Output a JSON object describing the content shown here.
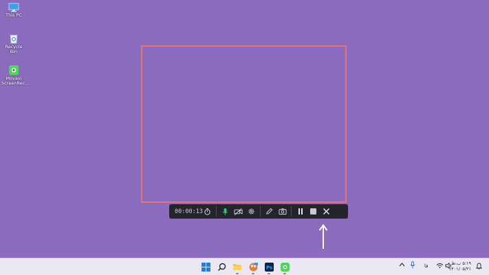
{
  "desktop": {
    "icons": [
      {
        "label": "This PC",
        "icon": "monitor-icon"
      },
      {
        "label": "Recycle Bin",
        "icon": "recycle-bin-icon"
      },
      {
        "label": "Movavi ScreenRec...",
        "icon": "movavi-screen-recorder-icon"
      }
    ]
  },
  "recorder": {
    "timer": "00:00:13",
    "frame_color": "#e8736a",
    "mic_color": "#2ecc71",
    "tools": [
      "stopwatch-icon",
      "microphone-icon",
      "webcam-off-icon",
      "settings-icon",
      "pencil-icon",
      "camera-icon",
      "pause-icon",
      "stop-icon",
      "close-icon"
    ]
  },
  "taskbar": {
    "apps": [
      "windows-start-icon",
      "search-icon",
      "file-explorer-icon",
      "game-app-icon",
      "photoshop-icon",
      "movavi-icon"
    ],
    "photoshop_label": "Ps",
    "tray": {
      "language": "فا",
      "time": "۵:۱۹ ب.ظ",
      "date": "۱۴۰۱/۰۵/۲۱"
    }
  },
  "colors": {
    "desktop_bg": "#8b6bbd",
    "toolbar_bg": "#24252b"
  }
}
